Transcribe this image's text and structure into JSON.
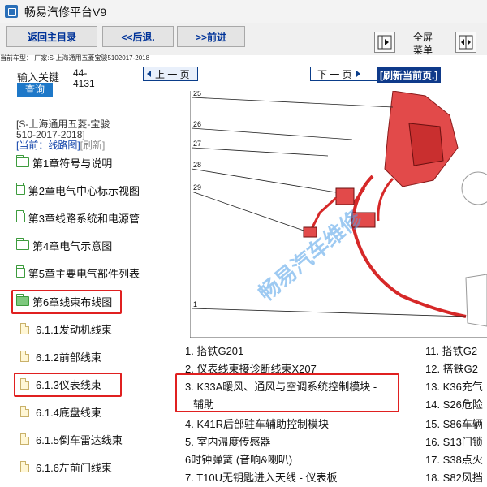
{
  "app": {
    "title": "畅易汽修平台V9"
  },
  "toolbar": {
    "home_label": "返回主目录",
    "back_label": "<<后退.",
    "forward_label": ">>前进",
    "fullscreen_menu_label_1": "全屏",
    "fullscreen_menu_label_2": "菜单"
  },
  "vehicle": {
    "label": "当前车型： 厂家:S-上海通用五菱宝骏5102017-2018"
  },
  "sidebar": {
    "search_label": "输入关键",
    "search_button": "查询",
    "code_line1": "44-",
    "code_line2": "4131",
    "model_line1": "[S-上海通用五菱-宝骏",
    "model_line2": "510-2017-2018]",
    "model_current": "[当前：线路图]",
    "model_refresh": "[刷新]",
    "items": [
      {
        "label": "第1章符号与说明",
        "type": "folder"
      },
      {
        "label": "第2章电气中心标示视图",
        "type": "folder"
      },
      {
        "label": "第3章线路系统和电源管",
        "type": "folder"
      },
      {
        "label": "第4章电气示意图",
        "type": "folder"
      },
      {
        "label": "第5章主要电气部件列表",
        "type": "folder"
      },
      {
        "label": "第6章线束布线图",
        "type": "folder-open"
      },
      {
        "label": "6.1.1发动机线束",
        "type": "doc"
      },
      {
        "label": "6.1.2前部线束",
        "type": "doc"
      },
      {
        "label": "6.1.3仪表线束",
        "type": "doc"
      },
      {
        "label": "6.1.4底盘线束",
        "type": "doc"
      },
      {
        "label": "6.1.5倒车雷达线束",
        "type": "doc"
      },
      {
        "label": "6.1.6左前门线束",
        "type": "doc"
      }
    ]
  },
  "content": {
    "prev_page": "上 一 页",
    "next_page": "下 一 页",
    "refresh_page": "[刷新当前页.]",
    "watermark": "畅易汽车维修",
    "callouts": [
      "25",
      "26",
      "27",
      "28",
      "29",
      "1"
    ],
    "legend_left": [
      "1.  搭铁G201",
      "2.  仪表线束接诊断线束X207",
      "3. K33A暖风、通风与空调系统控制模块 -",
      "辅助",
      "4. K41R后部驻车辅助控制模块",
      "5.  室内温度传感器",
      "6时钟弹簧 (音响&喇叭)",
      "7. T10U无钥匙进入天线 - 仪表板"
    ],
    "legend_right": [
      "11.  搭铁G2",
      "12.  搭铁G2",
      "13. K36充气",
      "14. S26危险",
      "15. S86车辆",
      "16. S13门锁",
      "17. S38点火",
      "18. S82风挡"
    ]
  }
}
